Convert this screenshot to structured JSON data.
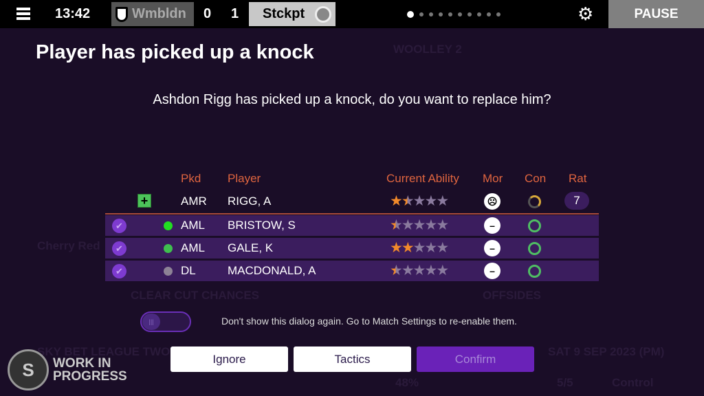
{
  "topbar": {
    "clock": "13:42",
    "home_team": "Wmbldn",
    "home_score": "0",
    "away_score": "1",
    "away_team": "Stckpt",
    "page_dots": 10,
    "active_dot": 0,
    "pause_label": "PAUSE"
  },
  "background": {
    "scorer": "WOOLLEY 2",
    "stadium": "Cherry Red",
    "stat1": "CLEAR CUT CHANCES",
    "stat2": "OFFSIDES",
    "competition": "SKY BET LEAGUE TWO",
    "date": "SAT 9 SEP 2023 (PM)",
    "possession": "48%",
    "subs": "5/5",
    "control": "Control"
  },
  "dialog": {
    "title": "Player has picked up a knock",
    "message": "Ashdon Rigg has picked up a knock, do you want to replace him?",
    "columns": {
      "pkd": "Pkd",
      "player": "Player",
      "ability": "Current Ability",
      "mor": "Mor",
      "con": "Con",
      "rat": "Rat"
    },
    "injured": {
      "pos": "AMR",
      "name": "RIGG, A",
      "stars": 1.5,
      "morale": "sad",
      "condition": "partial",
      "rating": "7"
    },
    "replacements": [
      {
        "pos": "AML",
        "name": "BRISTOW, S",
        "stars": 0.5,
        "dot_color": "#22dd22",
        "morale": "neutral",
        "condition": "full",
        "selected": true
      },
      {
        "pos": "AML",
        "name": "GALE, K",
        "stars": 2,
        "dot_color": "#3fbf4f",
        "morale": "neutral",
        "condition": "full",
        "selected": true
      },
      {
        "pos": "DL",
        "name": "MACDONALD, A",
        "stars": 0.5,
        "dot_color": "#8d8296",
        "morale": "neutral",
        "condition": "full",
        "selected": true
      }
    ],
    "dont_show_toggle": false,
    "dont_show_text": "Don't show this dialog again. Go to Match Settings to re-enable them.",
    "buttons": {
      "ignore": "Ignore",
      "tactics": "Tactics",
      "confirm": "Confirm"
    }
  },
  "watermark": {
    "line1": "WORK IN",
    "line2": "PROGRESS",
    "seal": "SPORTS INTERACTIVE"
  },
  "colors": {
    "header": "#e0653f",
    "star_on": "#f28a2a",
    "star_off": "#8a7a9e",
    "row": "#3b1d5e",
    "confirm": "#6a22b8"
  }
}
